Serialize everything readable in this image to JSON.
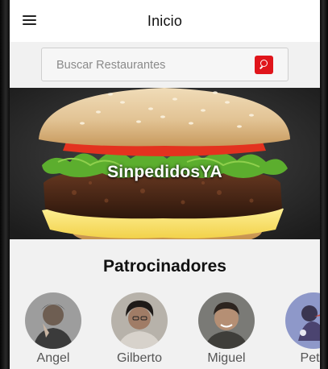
{
  "appbar": {
    "title": "Inicio",
    "menu_icon": "hamburger-menu-icon"
  },
  "search": {
    "placeholder": "Buscar Restaurantes",
    "value": "",
    "button_icon": "search-icon",
    "button_color": "#e0151b"
  },
  "banner": {
    "title": "SinpedidosYA",
    "image": "burger-photo"
  },
  "sponsors": {
    "title": "Patrocinadores",
    "items": [
      {
        "name": "Angel"
      },
      {
        "name": "Gilberto"
      },
      {
        "name": "Miguel"
      },
      {
        "name": "Pete"
      }
    ]
  }
}
